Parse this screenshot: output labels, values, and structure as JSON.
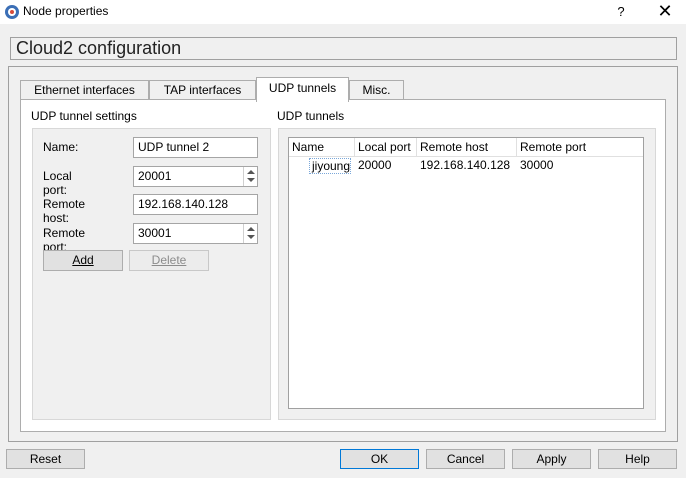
{
  "window": {
    "title": "Node properties",
    "help_label": "?",
    "close_label": "✕"
  },
  "config_title": "Cloud2 configuration",
  "tabs": [
    {
      "label": "Ethernet interfaces"
    },
    {
      "label": "TAP interfaces"
    },
    {
      "label": "UDP tunnels",
      "active": true
    },
    {
      "label": "Misc."
    }
  ],
  "settings": {
    "group_title": "UDP tunnel settings",
    "name_label": "Name:",
    "name_value": "UDP tunnel 2",
    "local_port_label": "Local port:",
    "local_port_value": "20001",
    "remote_host_label": "Remote host:",
    "remote_host_value": "192.168.140.128",
    "remote_port_label": "Remote port:",
    "remote_port_value": "30001",
    "add_label": "Add",
    "delete_label": "Delete"
  },
  "tunnels": {
    "group_title": "UDP tunnels",
    "columns": [
      "Name",
      "Local port",
      "Remote host",
      "Remote port"
    ],
    "rows": [
      {
        "name": "jiyoung",
        "local_port": "20000",
        "remote_host": "192.168.140.128",
        "remote_port": "30000"
      }
    ]
  },
  "footer": {
    "reset_label": "Reset",
    "ok_label": "OK",
    "cancel_label": "Cancel",
    "apply_label": "Apply",
    "help_label": "Help"
  },
  "icons": {
    "app": "gns3-node-icon",
    "spin_up": "spin-up-icon",
    "spin_down": "spin-down-icon"
  },
  "colors": {
    "window_bg": "#f0f0f0",
    "focus_border": "#0078d7",
    "selection_border": "#7aa7d9"
  }
}
